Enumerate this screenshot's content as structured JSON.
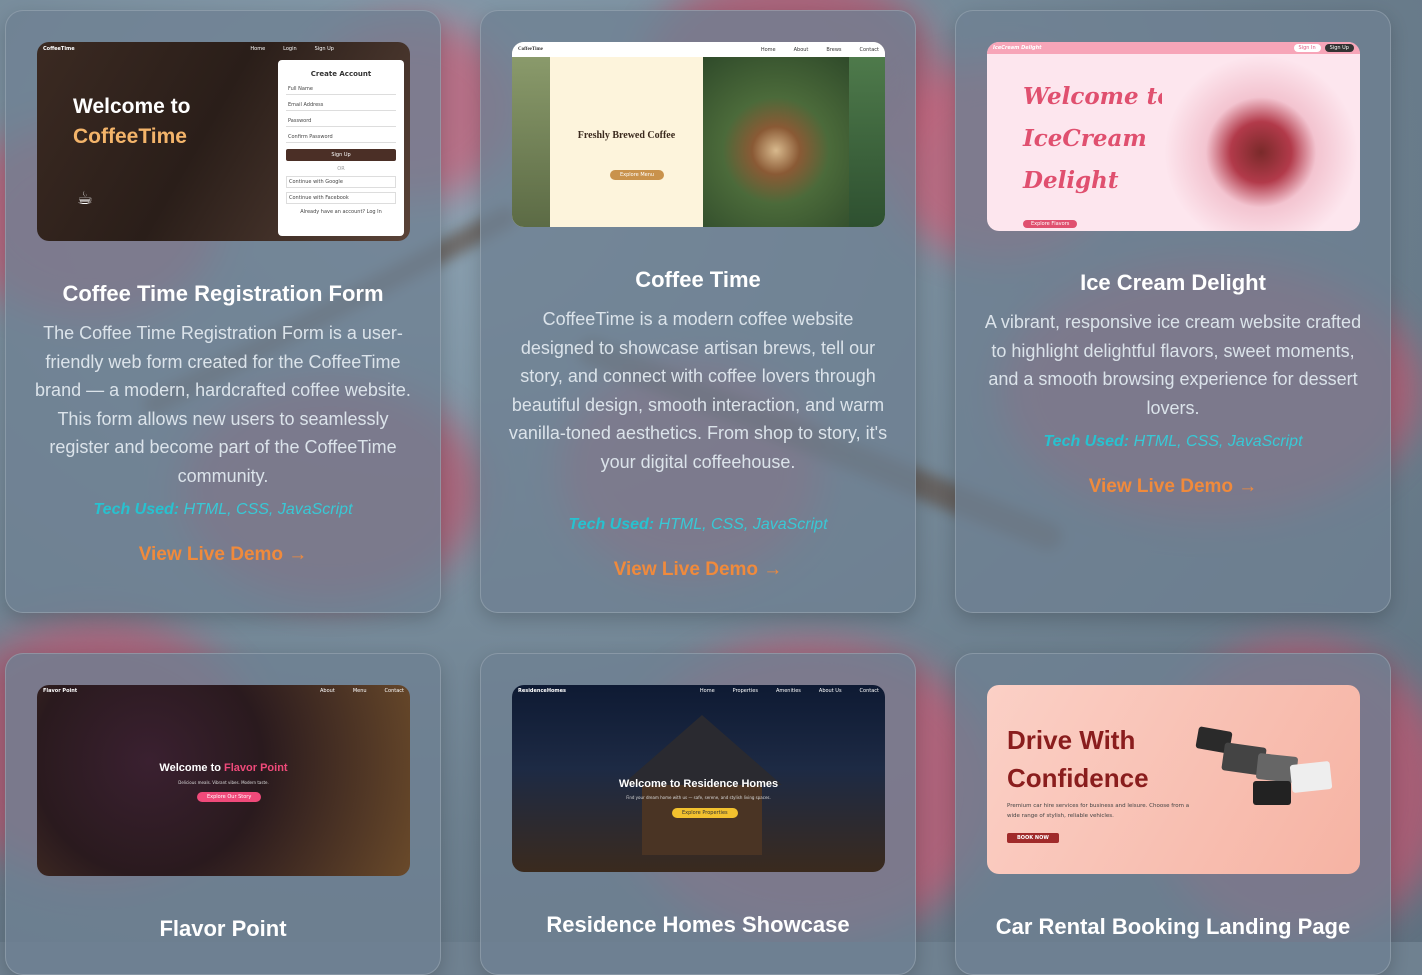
{
  "cards": [
    {
      "title": "Coffee Time Registration Form",
      "description": "The Coffee Time Registration Form is a user-friendly web form created for the CoffeeTime brand — a modern, hardcrafted coffee website. This form allows new users to seamlessly register and become part of the CoffeeTime community.",
      "tech_label": "Tech Used:",
      "tech_value": " HTML, CSS, JavaScript",
      "demo_label": "View Live Demo →",
      "thumb": {
        "brand": "CoffeeTime",
        "nav": [
          "Home",
          "Login",
          "Sign Up"
        ],
        "hero_line1": "Welcome to",
        "hero_line2": "CoffeeTime",
        "form_title": "Create Account",
        "fields": [
          "Full Name",
          "Email Address",
          "Password",
          "Confirm Password"
        ],
        "signup_btn": "Sign Up",
        "or": "OR",
        "google": "Continue with Google",
        "facebook": "Continue with Facebook",
        "login_prompt": "Already have an account? Log In"
      }
    },
    {
      "title": "Coffee Time",
      "description": "CoffeeTime is a modern coffee website designed to showcase artisan brews, tell our story, and connect with coffee lovers through beautiful design, smooth interaction, and warm vanilla-toned aesthetics. From shop to story, it's your digital coffeehouse.",
      "tech_label": "Tech Used:",
      "tech_value": " HTML, CSS, JavaScript",
      "demo_label": "View Live Demo →",
      "thumb": {
        "brand": "CoffeeTime",
        "nav": [
          "Home",
          "About",
          "Brews",
          "Contact"
        ],
        "heading": "Freshly Brewed Coffee",
        "button": "Explore Menu"
      }
    },
    {
      "title": "Ice Cream Delight",
      "description": "A vibrant, responsive ice cream website crafted to highlight delightful flavors, sweet moments, and a smooth browsing experience for dessert lovers.",
      "tech_label": "Tech Used:",
      "tech_value": " HTML, CSS, JavaScript",
      "demo_label": "View Live Demo →",
      "thumb": {
        "brand": "IceCream Delight",
        "hero_line1": "Welcome to",
        "hero_line2": "IceCream",
        "hero_line3": "Delight",
        "button": "Explore Flavors",
        "signin": "Sign In",
        "signup": "Sign Up"
      }
    },
    {
      "title": "Flavor Point",
      "thumb": {
        "brand": "Flavor Point",
        "nav": [
          "About",
          "Menu",
          "Contact"
        ],
        "welcome": "Welcome to ",
        "welcome_accent": "Flavor Point",
        "sub": "Delicious meals. Vibrant vibes. Modern taste.",
        "button": "Explore Our Story"
      }
    },
    {
      "title": "Residence Homes Showcase",
      "thumb": {
        "brand": "ResidenceHomes",
        "nav": [
          "Home",
          "Properties",
          "Amenities",
          "About Us",
          "Contact"
        ],
        "heading": "Welcome to Residence Homes",
        "sub": "Find your dream home with us — safe, serene, and stylish living spaces.",
        "button": "Explore Properties"
      }
    },
    {
      "title": "Car Rental Booking Landing Page",
      "thumb": {
        "line1": "Drive With",
        "line2": "Confidence",
        "sub": "Premium car hire services for business and leisure. Choose from a wide range of stylish, reliable vehicles.",
        "button": "BOOK NOW"
      }
    }
  ],
  "colors": {
    "accent_orange": "#f08a3c",
    "tech_cyan": "#27c2d0",
    "card_bg": "rgba(110,128,146,0.78)"
  }
}
